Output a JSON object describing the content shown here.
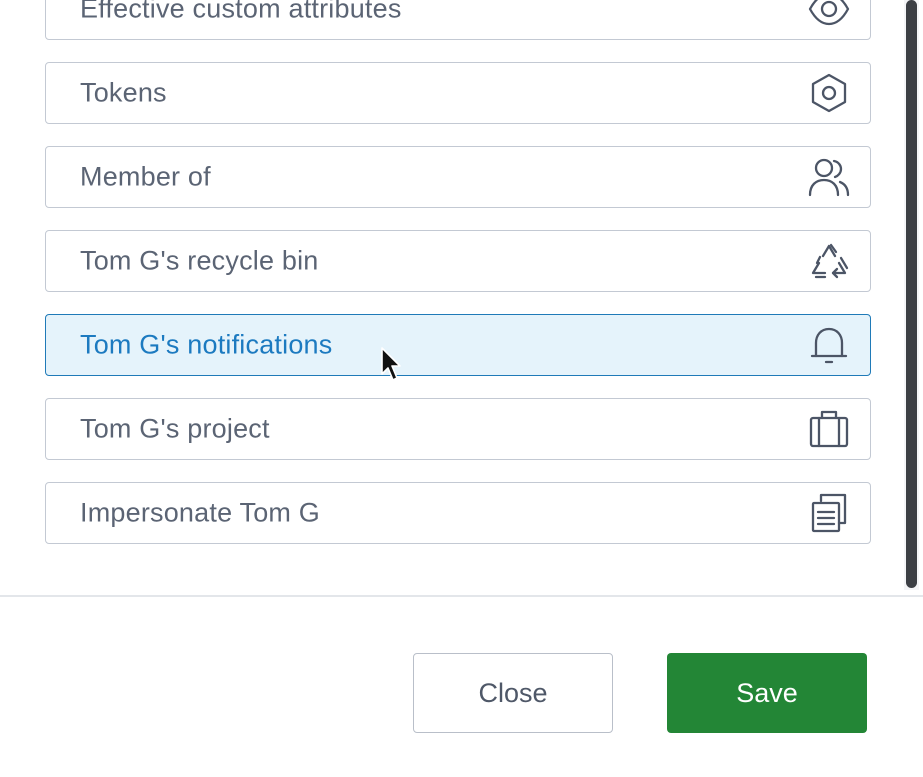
{
  "list": {
    "items": [
      {
        "label": "Effective custom attributes",
        "icon": "eye-icon",
        "active": false
      },
      {
        "label": "Tokens",
        "icon": "hexagon-nut-icon",
        "active": false
      },
      {
        "label": "Member of",
        "icon": "users-icon",
        "active": false
      },
      {
        "label": "Tom G's recycle bin",
        "icon": "recycle-icon",
        "active": false
      },
      {
        "label": "Tom G's notifications",
        "icon": "bell-icon",
        "active": true
      },
      {
        "label": "Tom G's project",
        "icon": "briefcase-icon",
        "active": false
      },
      {
        "label": "Impersonate Tom G",
        "icon": "copy-documents-icon",
        "active": false
      }
    ]
  },
  "footer": {
    "close_label": "Close",
    "save_label": "Save"
  },
  "colors": {
    "accent": "#1c7ac0",
    "active_background": "#e5f3fb",
    "save_button": "#238636",
    "border": "#c3c9d3",
    "text": "#5b6474"
  }
}
